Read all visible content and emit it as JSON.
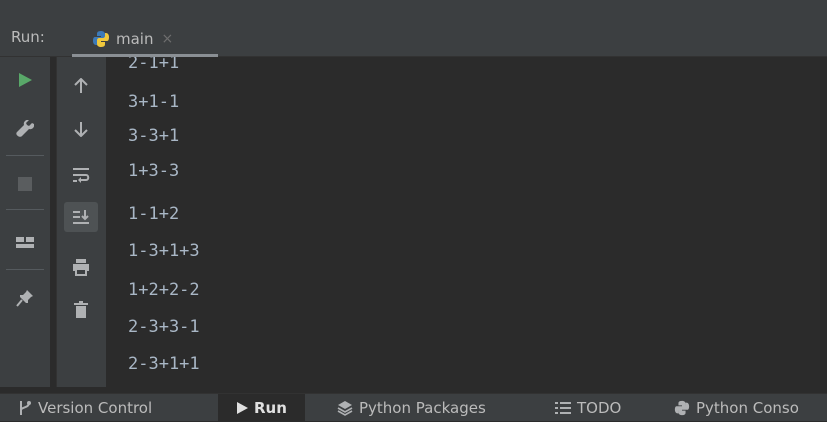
{
  "header": {
    "run_label": "Run:",
    "tab_name": "main",
    "tab_close": "×"
  },
  "console": {
    "lines": [
      "2-1+1",
      "3+1-1",
      "3-3+1",
      "1+3-3",
      "1-1+2",
      "1-3+1+3",
      "1+2+2-2",
      "2-3+3-1",
      "2-3+1+1"
    ]
  },
  "bottombar": {
    "version_control": "Version Control",
    "run": "Run",
    "python_packages": "Python Packages",
    "todo": "TODO",
    "python_console": "Python Conso"
  },
  "colors": {
    "run_green": "#59a869",
    "console_text": "#a9b7c6",
    "panel_bg": "#3c3f41",
    "editor_bg": "#2b2b2b"
  },
  "icons": {
    "toolbar1": [
      "play-icon",
      "wrench-icon",
      "stop-icon",
      "layout-icon",
      "pin-icon"
    ],
    "toolbar2": [
      "arrow-up-icon",
      "arrow-down-icon",
      "soft-wrap-icon",
      "scroll-to-end-icon",
      "print-icon",
      "trash-icon"
    ]
  }
}
